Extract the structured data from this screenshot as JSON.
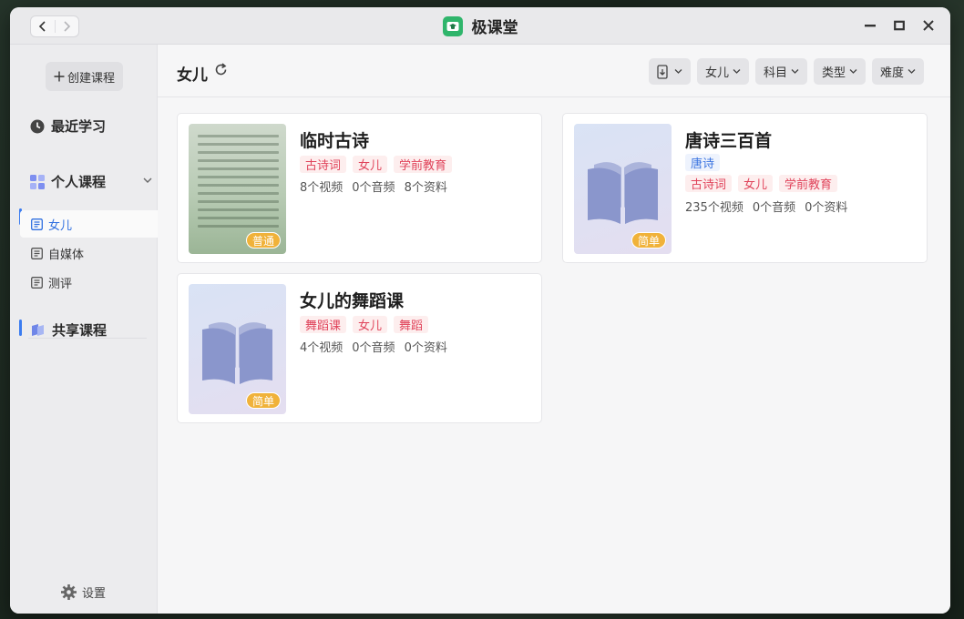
{
  "app": {
    "title": "极课堂"
  },
  "sidebar": {
    "create_label": "创建课程",
    "recent_label": "最近学习",
    "personal_label": "个人课程",
    "items": [
      {
        "label": "女儿"
      },
      {
        "label": "自媒体"
      },
      {
        "label": "测评"
      }
    ],
    "shared_label": "共享课程",
    "settings_label": "设置"
  },
  "main": {
    "title": "女儿",
    "filters": [
      {
        "label": ""
      },
      {
        "label": "女儿"
      },
      {
        "label": "科目"
      },
      {
        "label": "类型"
      },
      {
        "label": "难度"
      }
    ]
  },
  "courses": [
    {
      "title": "临时古诗",
      "level": "普通",
      "cover": "poem",
      "tags_blue": [],
      "tags": [
        "古诗词",
        "女儿",
        "学前教育"
      ],
      "stats": [
        "8个视频",
        "0个音频",
        "8个资料"
      ]
    },
    {
      "title": "唐诗三百首",
      "level": "简单",
      "cover": "book",
      "tags_blue": [
        "唐诗"
      ],
      "tags": [
        "古诗词",
        "女儿",
        "学前教育"
      ],
      "stats": [
        "235个视频",
        "0个音频",
        "0个资料"
      ]
    },
    {
      "title": "女儿的舞蹈课",
      "level": "简单",
      "cover": "book",
      "tags_blue": [],
      "tags": [
        "舞蹈课",
        "女儿",
        "舞蹈"
      ],
      "stats": [
        "4个视频",
        "0个音频",
        "0个资料"
      ]
    }
  ],
  "colors": {
    "accent": "#3b7cf0",
    "tag_red": "#e0435a",
    "badge": "#f0b23a"
  }
}
